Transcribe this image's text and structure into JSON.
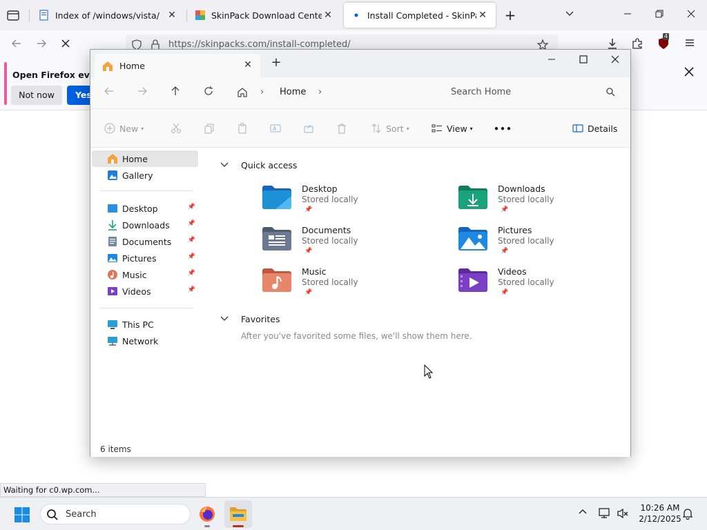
{
  "browser": {
    "tabs": [
      {
        "label": "Index of /windows/vista/",
        "close": "✕"
      },
      {
        "label": "SkinPack Download Center skin",
        "close": "✕"
      },
      {
        "label": "Install Completed - SkinPack",
        "close": "✕",
        "active": true
      }
    ],
    "new_tab": "+",
    "url": "https://skinpacks.com/install-completed/",
    "notification": {
      "text": "Open Firefox every t",
      "not_now": "Not now",
      "yes": "Yes,"
    },
    "status_text": "Waiting for c0.wp.com...",
    "extension_badge": "4"
  },
  "explorer": {
    "tab_title": "Home",
    "breadcrumb": [
      "Home"
    ],
    "search_placeholder": "Search Home",
    "toolbar": {
      "new": "New",
      "sort": "Sort",
      "view": "View",
      "more": "•••",
      "details": "Details"
    },
    "sidebar": {
      "top": [
        {
          "label": "Home",
          "icon": "home-icon"
        },
        {
          "label": "Gallery",
          "icon": "gallery-icon"
        }
      ],
      "pinned": [
        {
          "label": "Desktop",
          "icon": "desktop-icon"
        },
        {
          "label": "Downloads",
          "icon": "downloads-icon"
        },
        {
          "label": "Documents",
          "icon": "documents-icon"
        },
        {
          "label": "Pictures",
          "icon": "pictures-icon"
        },
        {
          "label": "Music",
          "icon": "music-icon"
        },
        {
          "label": "Videos",
          "icon": "videos-icon"
        }
      ],
      "bottom": [
        {
          "label": "This PC",
          "icon": "this-pc-icon"
        },
        {
          "label": "Network",
          "icon": "network-icon"
        }
      ]
    },
    "quick_access": {
      "title": "Quick access",
      "items": [
        {
          "name": "Desktop",
          "sub": "Stored locally",
          "color": "#1e90d6"
        },
        {
          "name": "Downloads",
          "sub": "Stored locally",
          "color": "#1aa37a"
        },
        {
          "name": "Documents",
          "sub": "Stored locally",
          "color": "#6b7a90"
        },
        {
          "name": "Pictures",
          "sub": "Stored locally",
          "color": "#1e88e5"
        },
        {
          "name": "Music",
          "sub": "Stored locally",
          "color": "#e0745a"
        },
        {
          "name": "Videos",
          "sub": "Stored locally",
          "color": "#7b3fc4"
        }
      ]
    },
    "favorites": {
      "title": "Favorites",
      "empty_text": "After you've favorited some files, we'll show them here."
    },
    "status": "6 items"
  },
  "taskbar": {
    "search_placeholder": "Search",
    "time": "10:26 AM",
    "date": "2/12/2025"
  },
  "colors": {
    "firefox_blue": "#0061e0",
    "notif_accent": "#e85b9e",
    "folder_yellow": "#f3c044"
  }
}
